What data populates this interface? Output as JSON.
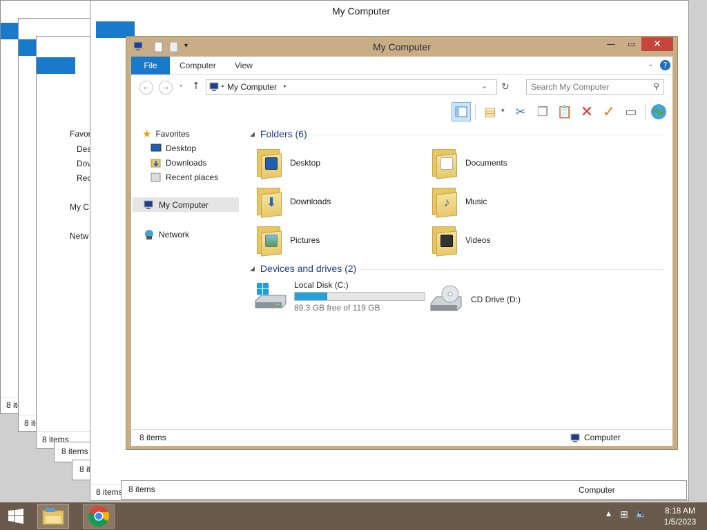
{
  "window": {
    "title": "My Computer",
    "ribbon_tabs": [
      "File",
      "Computer",
      "View"
    ],
    "address": "My Computer",
    "search_placeholder": "Search My Computer",
    "status_items": "8 items",
    "status_location": "Computer"
  },
  "nav": {
    "favorites": "Favorites",
    "fav_items": [
      "Desktop",
      "Downloads",
      "Recent places"
    ],
    "computer": "My Computer",
    "network": "Network"
  },
  "content": {
    "folders_header": "Folders (6)",
    "folders": [
      {
        "name": "Desktop",
        "icon": "desktop-folder-icon"
      },
      {
        "name": "Documents",
        "icon": "documents-folder-icon"
      },
      {
        "name": "Downloads",
        "icon": "downloads-folder-icon"
      },
      {
        "name": "Music",
        "icon": "music-folder-icon"
      },
      {
        "name": "Pictures",
        "icon": "pictures-folder-icon"
      },
      {
        "name": "Videos",
        "icon": "videos-folder-icon"
      }
    ],
    "devices_header": "Devices and drives (2)",
    "drives": [
      {
        "name": "Local Disk (C:)",
        "free": "89.3 GB free of 119 GB",
        "used_fraction": 0.25
      },
      {
        "name": "CD Drive (D:)"
      }
    ]
  },
  "bg_windows": {
    "status_items": "8 items",
    "status_location": "Computer",
    "nav_labels": [
      "Favor",
      "Des",
      "Dov",
      "Rec",
      "My C",
      "Netw"
    ]
  },
  "taskbar": {
    "time": "8:18 AM",
    "date": "1/5/2023"
  },
  "colors": {
    "accent": "#1979ca",
    "frame": "#c9ad86",
    "close": "#c7463b",
    "taskbar": "#6a5a4c",
    "drive_bar": "#26a0da"
  }
}
